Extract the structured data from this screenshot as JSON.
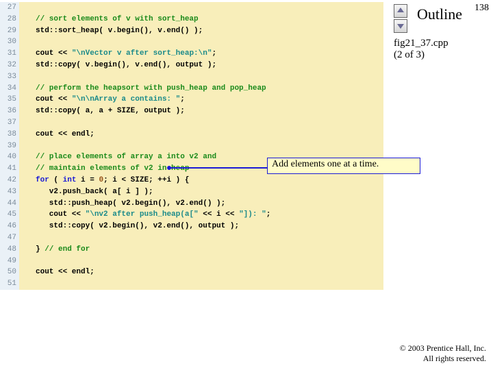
{
  "page_number": "138",
  "outline_label": "Outline",
  "caption_line1": "fig21_37.cpp",
  "caption_line2": "(2 of 3)",
  "callout_text": "Add elements one at a time.",
  "footer_line1": "© 2003 Prentice Hall, Inc.",
  "footer_line2": "All rights reserved.",
  "lines": [
    {
      "n": "27",
      "seg": []
    },
    {
      "n": "28",
      "seg": [
        {
          "c": "c-comment",
          "t": "// sort elements of v with sort_heap"
        }
      ]
    },
    {
      "n": "29",
      "seg": [
        {
          "t": "std::sort_heap( v.begin(), v.end() );"
        }
      ]
    },
    {
      "n": "30",
      "seg": []
    },
    {
      "n": "31",
      "seg": [
        {
          "t": "cout << "
        },
        {
          "c": "c-str",
          "t": "\"\\nVector v after sort_heap:\\n\""
        },
        {
          "t": ";"
        }
      ]
    },
    {
      "n": "32",
      "seg": [
        {
          "t": "std::copy( v.begin(), v.end(), output );"
        }
      ]
    },
    {
      "n": "33",
      "seg": []
    },
    {
      "n": "34",
      "seg": [
        {
          "c": "c-comment",
          "t": "// perform the heapsort with push_heap and pop_heap"
        }
      ]
    },
    {
      "n": "35",
      "seg": [
        {
          "t": "cout << "
        },
        {
          "c": "c-str",
          "t": "\"\\n\\nArray a contains: \""
        },
        {
          "t": ";"
        }
      ]
    },
    {
      "n": "36",
      "seg": [
        {
          "t": "std::copy( a, a + SIZE, output );"
        }
      ]
    },
    {
      "n": "37",
      "seg": []
    },
    {
      "n": "38",
      "seg": [
        {
          "t": "cout << endl;"
        }
      ]
    },
    {
      "n": "39",
      "seg": []
    },
    {
      "n": "40",
      "seg": [
        {
          "c": "c-comment",
          "t": "// place elements of array a into v2 and"
        }
      ]
    },
    {
      "n": "41",
      "seg": [
        {
          "c": "c-comment",
          "t": "// maintain elements of v2 in heap"
        }
      ]
    },
    {
      "n": "42",
      "seg": [
        {
          "c": "c-key",
          "t": "for"
        },
        {
          "t": " ( "
        },
        {
          "c": "c-key",
          "t": "int"
        },
        {
          "t": " i = "
        },
        {
          "c": "c-num",
          "t": "0"
        },
        {
          "t": "; i < SIZE; ++i ) {"
        }
      ]
    },
    {
      "n": "43",
      "seg": [
        {
          "t": "   v2.push_back( a[ i ] );"
        }
      ]
    },
    {
      "n": "44",
      "seg": [
        {
          "t": "   std::push_heap( v2.begin(), v2.end() );"
        }
      ]
    },
    {
      "n": "45",
      "seg": [
        {
          "t": "   cout << "
        },
        {
          "c": "c-str",
          "t": "\"\\nv2 after push_heap(a[\""
        },
        {
          "t": " << i << "
        },
        {
          "c": "c-str",
          "t": "\"]): \""
        },
        {
          "t": ";"
        }
      ]
    },
    {
      "n": "46",
      "seg": [
        {
          "t": "   std::copy( v2.begin(), v2.end(), output );"
        }
      ]
    },
    {
      "n": "47",
      "seg": []
    },
    {
      "n": "48",
      "seg": [
        {
          "t": "} "
        },
        {
          "c": "c-comment",
          "t": "// end for"
        }
      ]
    },
    {
      "n": "49",
      "seg": []
    },
    {
      "n": "50",
      "seg": [
        {
          "t": "cout << endl;"
        }
      ]
    },
    {
      "n": "51",
      "seg": []
    }
  ]
}
